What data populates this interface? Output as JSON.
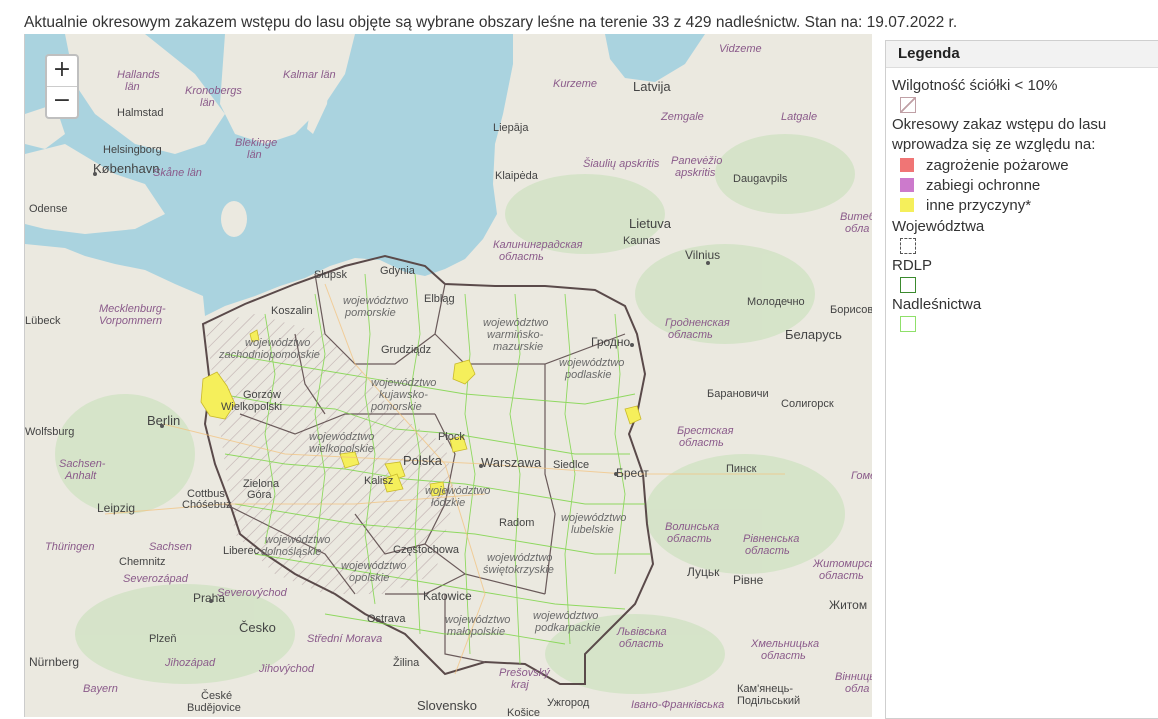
{
  "header": {
    "title": "Aktualnie okresowym zakazem wstępu do lasu objęte są wybrane obszary leśne na terenie 33 z 429 nadleśnictw. Stan na: 19.07.2022 r."
  },
  "map": {
    "zoom_in_label": "+",
    "zoom_out_label": "−",
    "labels": [
      {
        "text": "Hallands",
        "italic": true
      },
      {
        "text": "län",
        "italic": true
      },
      {
        "text": "Kronobergs",
        "italic": true
      },
      {
        "text": "län",
        "italic": true
      },
      {
        "text": "Kalmar län",
        "italic": true
      },
      {
        "text": "Halmstad",
        "italic": false
      },
      {
        "text": "Helsingborg",
        "italic": false
      },
      {
        "text": "Blekinge",
        "italic": true
      },
      {
        "text": "län",
        "italic": true
      },
      {
        "text": "Skåne län",
        "italic": true
      },
      {
        "text": "København",
        "italic": false
      },
      {
        "text": "Odense",
        "italic": false
      },
      {
        "text": "Lübeck",
        "italic": false
      },
      {
        "text": "Mecklenburg-",
        "italic": true
      },
      {
        "text": "Vorpommern",
        "italic": true
      },
      {
        "text": "Berlin",
        "italic": false
      },
      {
        "text": "Wolfsburg",
        "italic": false
      },
      {
        "text": "Sachsen-",
        "italic": true
      },
      {
        "text": "Anhalt",
        "italic": true
      },
      {
        "text": "Leipzig",
        "italic": false
      },
      {
        "text": "Cottbus",
        "italic": false
      },
      {
        "text": "Chóśebuz",
        "italic": false
      },
      {
        "text": "Sachsen",
        "italic": true
      },
      {
        "text": "Thüringen",
        "italic": true
      },
      {
        "text": "Chemnitz",
        "italic": false
      },
      {
        "text": "Severozápad",
        "italic": true
      },
      {
        "text": "Severovýchod",
        "italic": true
      },
      {
        "text": "Praha",
        "italic": false
      },
      {
        "text": "Česko",
        "italic": false
      },
      {
        "text": "Plzeň",
        "italic": false
      },
      {
        "text": "Nürnberg",
        "italic": false
      },
      {
        "text": "Jihozápad",
        "italic": true
      },
      {
        "text": "Jihovýchod",
        "italic": true
      },
      {
        "text": "Bayern",
        "italic": true
      },
      {
        "text": "České",
        "italic": false
      },
      {
        "text": "Budějovice",
        "italic": false
      },
      {
        "text": "Střední Morava",
        "italic": true
      },
      {
        "text": "Ostrava",
        "italic": false
      },
      {
        "text": "Žilina",
        "italic": false
      },
      {
        "text": "Slovensko",
        "italic": false
      },
      {
        "text": "Košice",
        "italic": false
      },
      {
        "text": "Prešovský",
        "italic": true
      },
      {
        "text": "kraj",
        "italic": true
      },
      {
        "text": "Ужгород",
        "italic": false
      },
      {
        "text": "Vidzeme",
        "italic": true
      },
      {
        "text": "Kurzeme",
        "italic": true
      },
      {
        "text": "Latvija",
        "italic": false
      },
      {
        "text": "Zemgale",
        "italic": true
      },
      {
        "text": "Latgale",
        "italic": true
      },
      {
        "text": "Liepāja",
        "italic": false
      },
      {
        "text": "Šiaulių apskritis",
        "italic": true
      },
      {
        "text": "Panevėžio",
        "italic": true
      },
      {
        "text": "apskritis",
        "italic": true
      },
      {
        "text": "Daugavpils",
        "italic": false
      },
      {
        "text": "Klaipėda",
        "italic": false
      },
      {
        "text": "Lietuva",
        "italic": false
      },
      {
        "text": "Kaunas",
        "italic": false
      },
      {
        "text": "Vilnius",
        "italic": false
      },
      {
        "text": "Калининградская",
        "italic": true
      },
      {
        "text": "область",
        "italic": true
      },
      {
        "text": "Витеб",
        "italic": true
      },
      {
        "text": "обла",
        "italic": true
      },
      {
        "text": "Молодечно",
        "italic": false
      },
      {
        "text": "Борисов",
        "italic": false
      },
      {
        "text": "Гродно",
        "italic": false
      },
      {
        "text": "Гродненская",
        "italic": true
      },
      {
        "text": "область",
        "italic": true
      },
      {
        "text": "Беларусь",
        "italic": false
      },
      {
        "text": "Барановичи",
        "italic": false
      },
      {
        "text": "Солигорск",
        "italic": false
      },
      {
        "text": "Брестская",
        "italic": true
      },
      {
        "text": "область",
        "italic": true
      },
      {
        "text": "Брест",
        "italic": false
      },
      {
        "text": "Пинск",
        "italic": false
      },
      {
        "text": "Гомел",
        "italic": true
      },
      {
        "text": "Волинська",
        "italic": true
      },
      {
        "text": "область",
        "italic": true
      },
      {
        "text": "Рівненська",
        "italic": true
      },
      {
        "text": "область",
        "italic": true
      },
      {
        "text": "Луцьк",
        "italic": false
      },
      {
        "text": "Рівне",
        "italic": false
      },
      {
        "text": "Житомирськ",
        "italic": true
      },
      {
        "text": "область",
        "italic": true
      },
      {
        "text": "Житом",
        "italic": false
      },
      {
        "text": "Львівська",
        "italic": true
      },
      {
        "text": "область",
        "italic": true
      },
      {
        "text": "Хмельницька",
        "italic": true
      },
      {
        "text": "область",
        "italic": true
      },
      {
        "text": "Кам'янець-",
        "italic": false
      },
      {
        "text": "Подільський",
        "italic": false
      },
      {
        "text": "Івано-Франківська",
        "italic": true
      },
      {
        "text": "Вінниць",
        "italic": true
      },
      {
        "text": "обла",
        "italic": true
      },
      {
        "text": "Słupsk",
        "italic": false
      },
      {
        "text": "Gdynia",
        "italic": false
      },
      {
        "text": "Elbląg",
        "italic": false
      },
      {
        "text": "Koszalin",
        "italic": false
      },
      {
        "text": "województwo",
        "italic": true
      },
      {
        "text": "pomorskie",
        "italic": true
      },
      {
        "text": "województwo",
        "italic": true
      },
      {
        "text": "warmińsko-",
        "italic": true
      },
      {
        "text": "mazurskie",
        "italic": true
      },
      {
        "text": "Grudziądz",
        "italic": false
      },
      {
        "text": "województwo",
        "italic": true
      },
      {
        "text": "zachodniopomorskie",
        "italic": true
      },
      {
        "text": "województwo",
        "italic": true
      },
      {
        "text": "podlaskie",
        "italic": true
      },
      {
        "text": "Gorzów",
        "italic": false
      },
      {
        "text": "Wielkopolski",
        "italic": false
      },
      {
        "text": "województwo",
        "italic": true
      },
      {
        "text": "kujawsko-",
        "italic": true
      },
      {
        "text": "pomorskie",
        "italic": true
      },
      {
        "text": "Płock",
        "italic": false
      },
      {
        "text": "województwo",
        "italic": true
      },
      {
        "text": "wielkopolskie",
        "italic": true
      },
      {
        "text": "Polska",
        "italic": false
      },
      {
        "text": "Warszawa",
        "italic": false
      },
      {
        "text": "Siedlce",
        "italic": false
      },
      {
        "text": "Zielona",
        "italic": false
      },
      {
        "text": "Góra",
        "italic": false
      },
      {
        "text": "Kalisz",
        "italic": false
      },
      {
        "text": "województwo",
        "italic": true
      },
      {
        "text": "łódzkie",
        "italic": true
      },
      {
        "text": "Radom",
        "italic": false
      },
      {
        "text": "województwo",
        "italic": true
      },
      {
        "text": "lubelskie",
        "italic": true
      },
      {
        "text": "Liberec",
        "italic": false
      },
      {
        "text": "województwo",
        "italic": true
      },
      {
        "text": "dolnośląskie",
        "italic": true
      },
      {
        "text": "Częstochowa",
        "italic": false
      },
      {
        "text": "województwo",
        "italic": true
      },
      {
        "text": "opolskie",
        "italic": true
      },
      {
        "text": "województwo",
        "italic": true
      },
      {
        "text": "świętokrzyskie",
        "italic": true
      },
      {
        "text": "Katowice",
        "italic": false
      },
      {
        "text": "województwo",
        "italic": true
      },
      {
        "text": "podkarpackie",
        "italic": true
      },
      {
        "text": "województwo",
        "italic": true
      },
      {
        "text": "małopolskie",
        "italic": true
      },
      {
        "text": "Zielona",
        "italic": false
      }
    ]
  },
  "legend": {
    "title": "Legenda",
    "layer_humidity": "Wilgotność ściółki < 10%",
    "layer_ban": "Okresowy zakaz wstępu do lasu wprowadza się ze względu na:",
    "items": [
      {
        "label": "zagrożenie pożarowe",
        "color": "#f07575"
      },
      {
        "label": "zabiegi ochronne",
        "color": "#cc7acc"
      },
      {
        "label": "inne przyczyny*",
        "color": "#f5ef5b"
      }
    ],
    "layer_voivodeships": "Województwa",
    "layer_rdlp": "RDLP",
    "layer_districts": "Nadleśnictwa"
  }
}
